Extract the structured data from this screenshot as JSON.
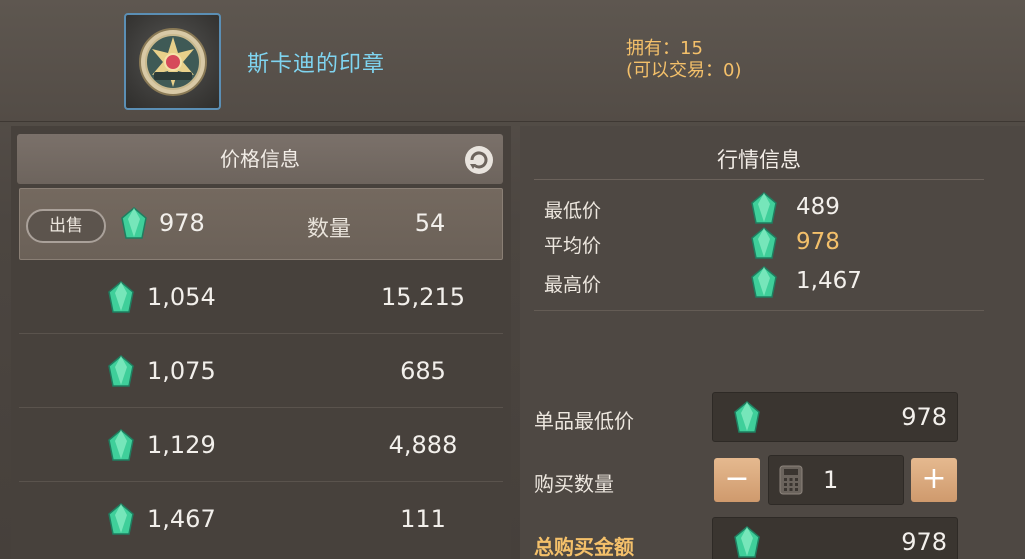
{
  "item": {
    "name": "斯卡迪的印章",
    "owned": "拥有：15",
    "tradable": "(可以交易：0)",
    "icon": "seal-icon"
  },
  "price_panel": {
    "title": "价格信息",
    "refresh_icon": "refresh-icon",
    "sell_label": "出售",
    "qty_label": "数量",
    "listings": [
      {
        "price": "978",
        "qty": "54"
      },
      {
        "price": "1,054",
        "qty": "15,215"
      },
      {
        "price": "1,075",
        "qty": "685"
      },
      {
        "price": "1,129",
        "qty": "4,888"
      },
      {
        "price": "1,467",
        "qty": "111"
      }
    ]
  },
  "market_panel": {
    "title": "行情信息",
    "lowest_label": "最低价",
    "lowest_value": "489",
    "average_label": "平均价",
    "average_value": "978",
    "highest_label": "最高价",
    "highest_value": "1,467"
  },
  "purchase": {
    "unit_min_label": "单品最低价",
    "unit_min_value": "978",
    "buy_qty_label": "购买数量",
    "buy_qty_value": "1",
    "minus_label": "−",
    "plus_label": "+",
    "total_label": "总购买金额",
    "total_value": "978"
  },
  "colors": {
    "accent_gold": "#f4c06a",
    "item_name": "#7fd4f0",
    "gem": "#3fcf9a"
  }
}
